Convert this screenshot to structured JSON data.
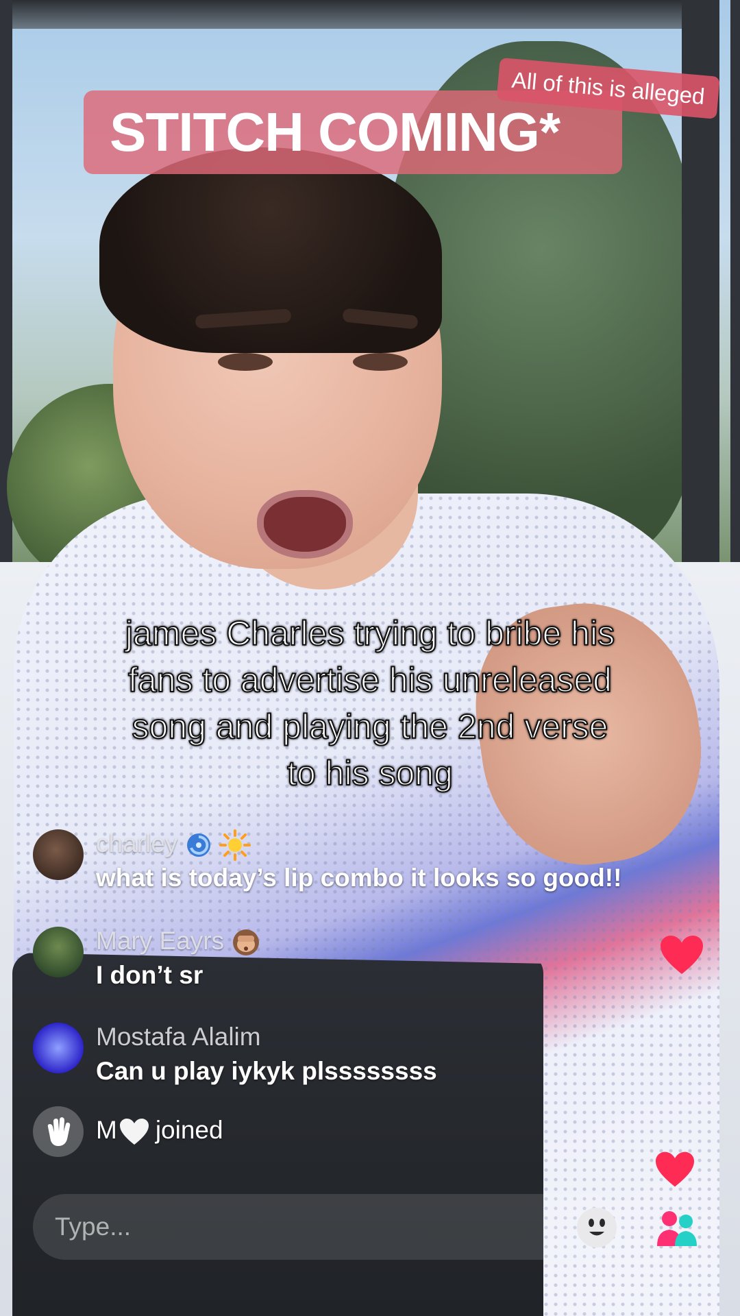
{
  "overlay": {
    "banner": "STITCH COMING*",
    "alleged_tag": "All of this is alleged",
    "caption": "james Charles trying to bribe his fans to advertise his unreleased song and playing the 2nd verse to his song"
  },
  "chat": {
    "messages": [
      {
        "name": "charley",
        "text": "what is today’s lip combo it looks so good!!"
      },
      {
        "name": "Mary Eayrs",
        "text": "I don’t sr"
      },
      {
        "name": "Mostafa Alalim",
        "text": "Can u play iykyk plssssssss"
      }
    ],
    "join_event": {
      "user": "M",
      "text": "joined"
    }
  },
  "input": {
    "placeholder": "Type..."
  },
  "colors": {
    "banner": "#de6978",
    "heart": "#fe2c55",
    "gift_pink": "#ff2f73",
    "gift_teal": "#25d0c7"
  },
  "icons": [
    "wave-icon",
    "emoji-icon",
    "gift-icon",
    "heart-icon",
    "white-heart-icon",
    "sun-icon",
    "cyclone-icon",
    "monkey-icon"
  ]
}
